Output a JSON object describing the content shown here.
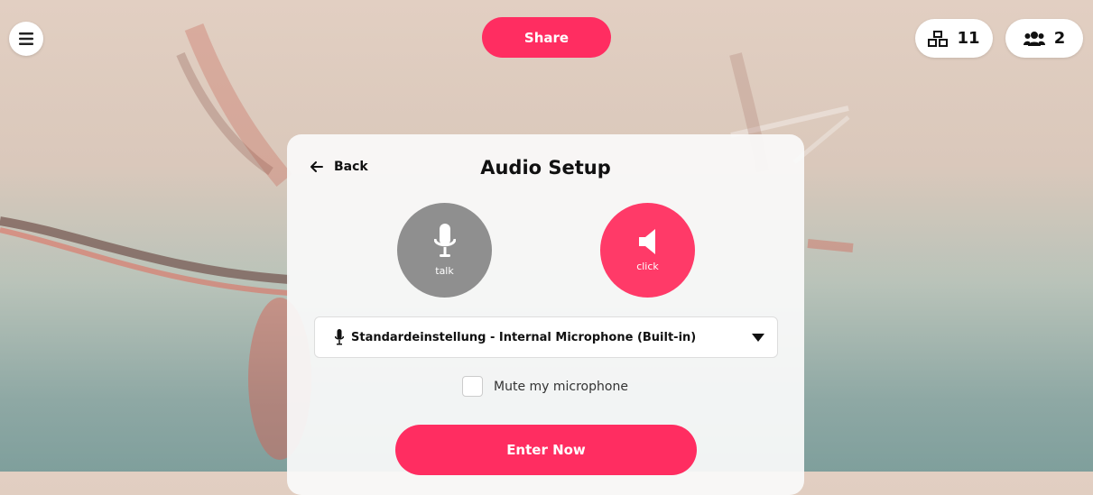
{
  "header": {
    "menu_icon": "hamburger-icon",
    "share_label": "Share",
    "objects_icon": "cubes-icon",
    "objects_count": "11",
    "users_icon": "users-icon",
    "users_count": "2"
  },
  "panel": {
    "back_label": "Back",
    "title": "Audio Setup",
    "talk_label": "talk",
    "click_label": "click",
    "device_select": {
      "selected": "Standardeinstellung - Internal Microphone (Built-in)"
    },
    "mute_label": "Mute my microphone",
    "mute_checked": false,
    "enter_label": "Enter Now"
  },
  "colors": {
    "accent": "#ff2d61",
    "talk_circle": "#8f8f8f",
    "click_circle": "#ff3a68"
  }
}
